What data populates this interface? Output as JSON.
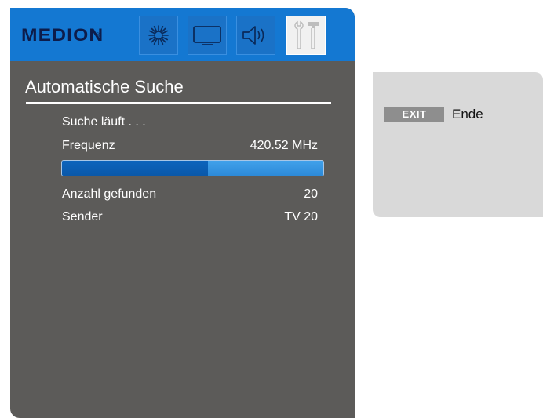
{
  "brand": {
    "logo_text": "MEDION",
    "logo_mark": "®"
  },
  "menu_tabs": [
    {
      "name": "picture",
      "icon": "brightness-icon",
      "active": false
    },
    {
      "name": "tv",
      "icon": "tv-icon",
      "active": false
    },
    {
      "name": "sound",
      "icon": "speaker-icon",
      "active": false
    },
    {
      "name": "tools",
      "icon": "tools-icon",
      "active": true
    }
  ],
  "screen": {
    "title": "Automatische Suche",
    "status": "Suche läuft . . .",
    "frequency_label": "Frequenz",
    "frequency_value": "420.52 MHz",
    "progress_percent": 56,
    "found_label": "Anzahl gefunden",
    "found_value": "20",
    "channel_label": "Sender",
    "channel_value": "TV 20"
  },
  "help": {
    "exit_key": "EXIT",
    "exit_desc": "Ende"
  },
  "colors": {
    "header_blue": "#1478d2",
    "panel_gray": "#5c5b59",
    "help_gray": "#d9d9d9",
    "progress_fill": "#0c64bd",
    "progress_track": "#41a1ea"
  }
}
